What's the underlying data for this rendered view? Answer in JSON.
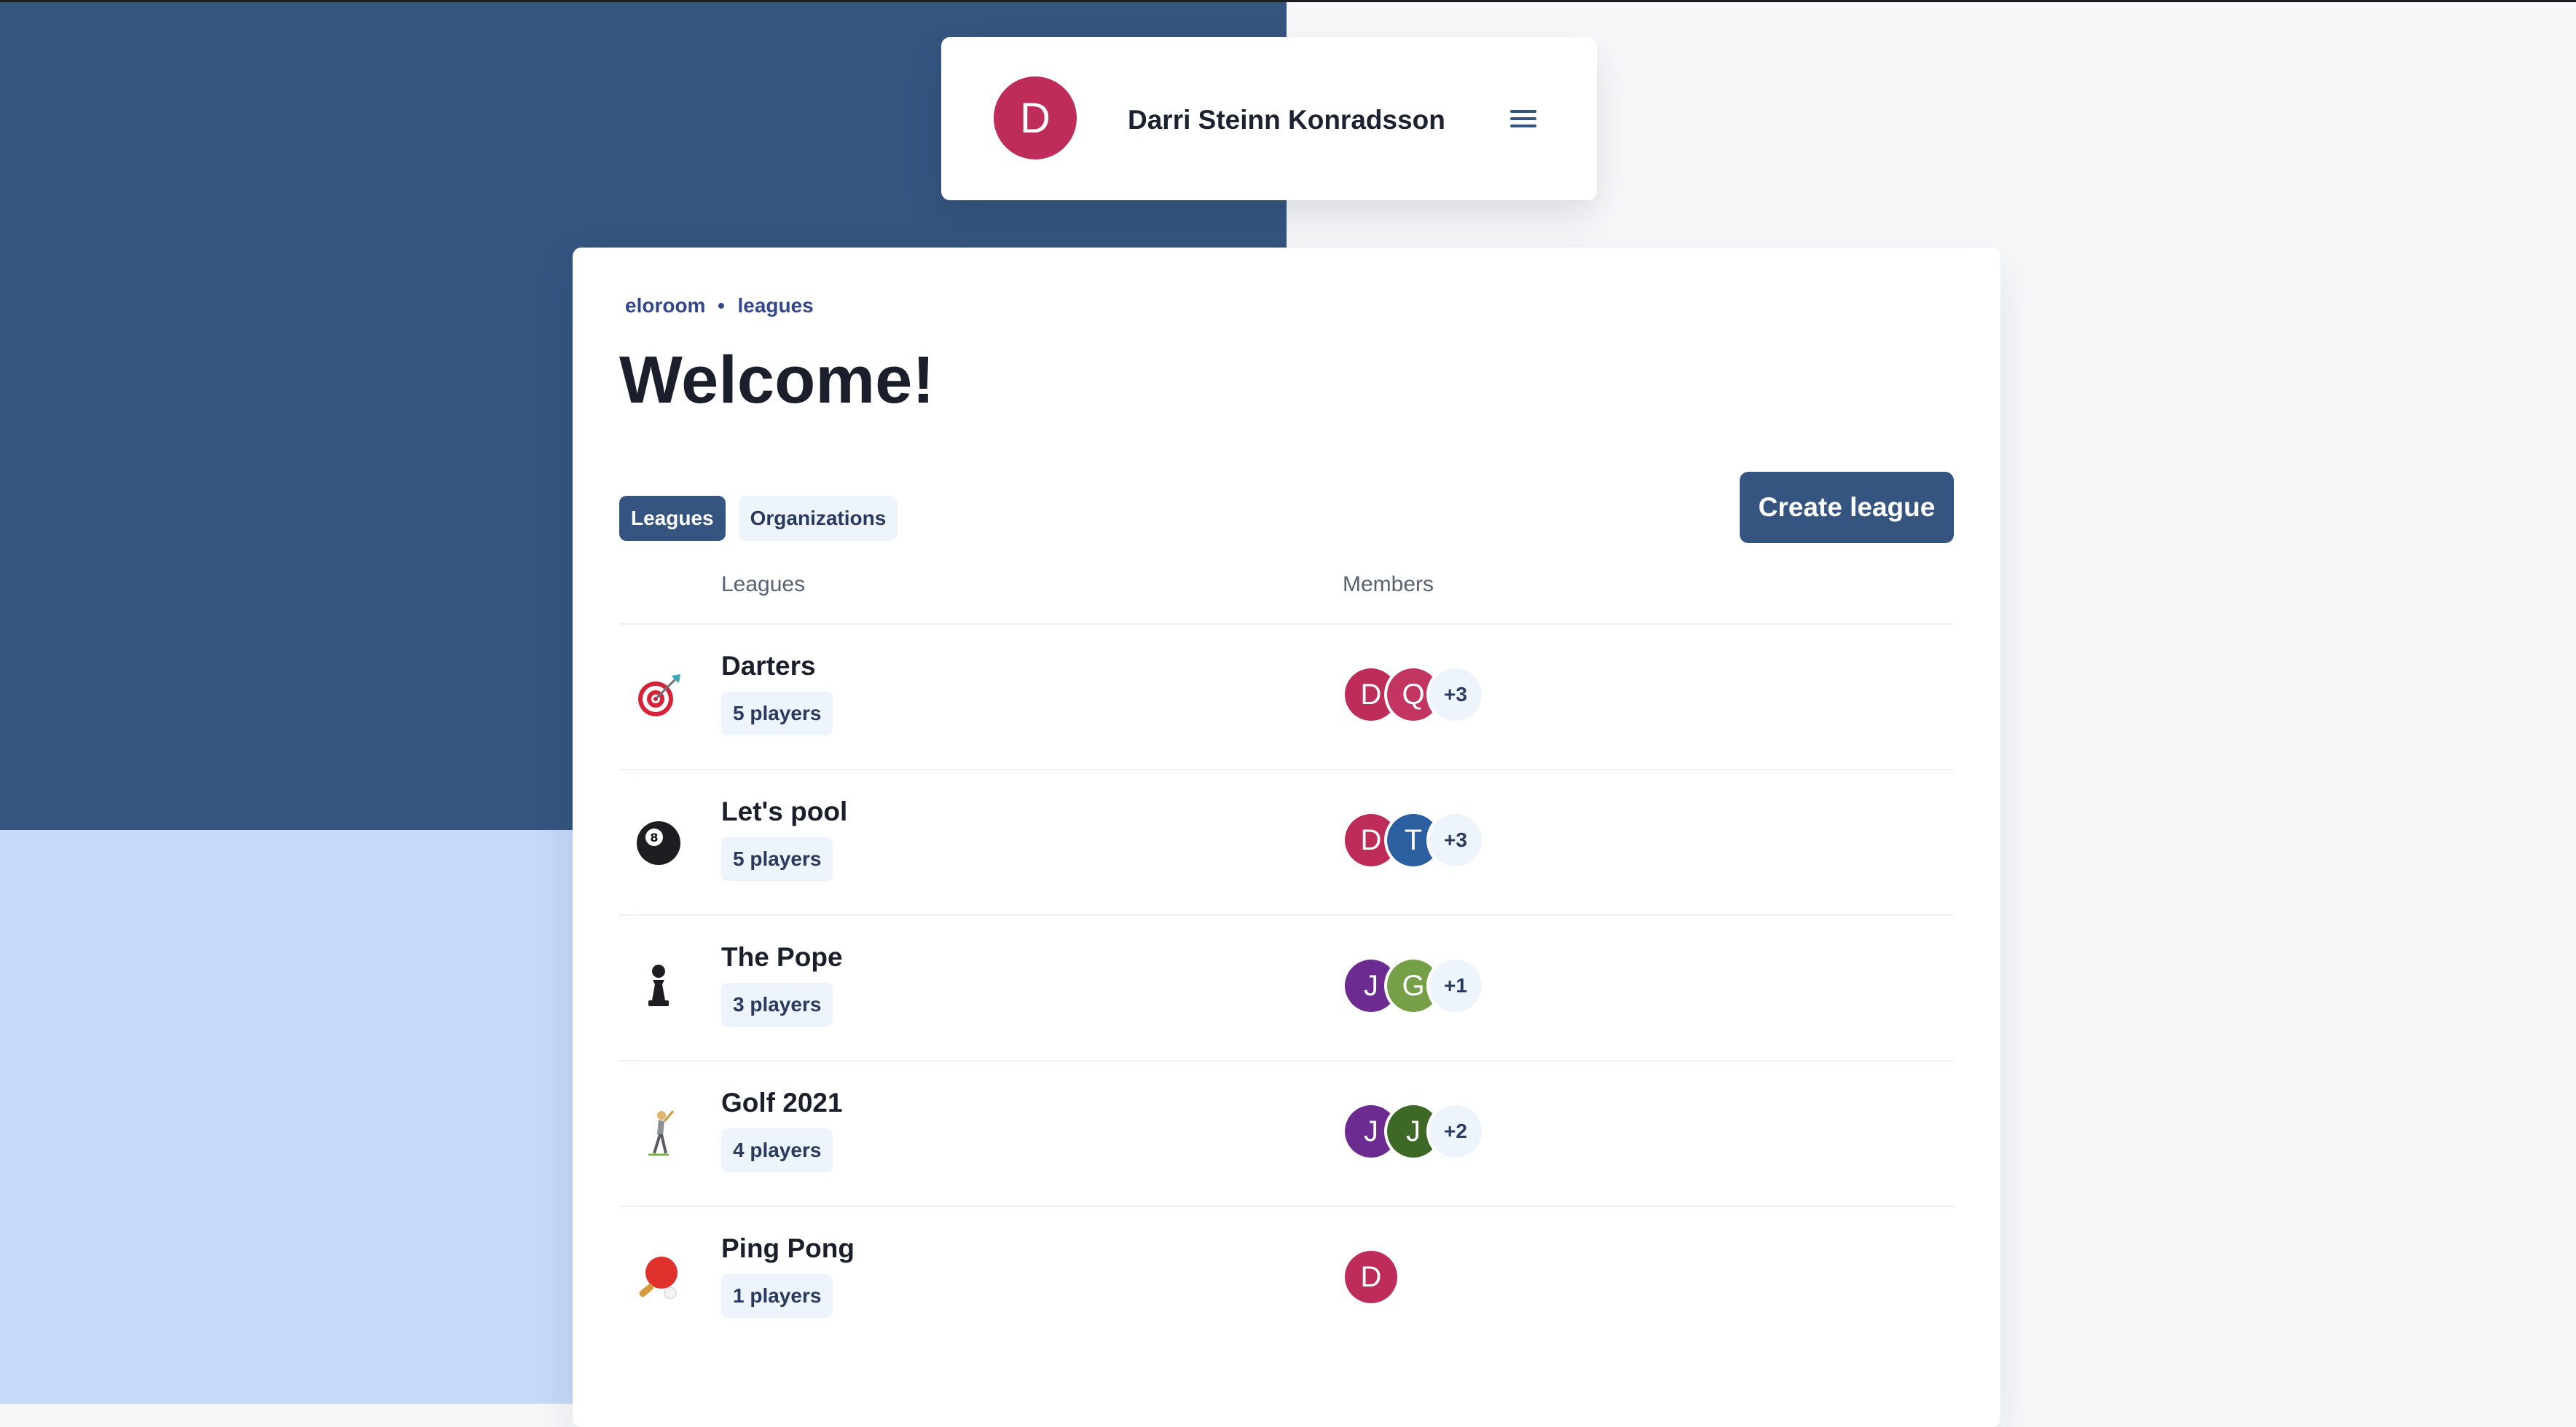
{
  "user": {
    "initial": "D",
    "name": "Darri Steinn Konradsson"
  },
  "breadcrumb": {
    "home": "eloroom",
    "current": "leagues"
  },
  "page": {
    "title": "Welcome!"
  },
  "tabs": [
    {
      "label": "Leagues",
      "active": true
    },
    {
      "label": "Organizations",
      "active": false
    }
  ],
  "actions": {
    "create_league": "Create league"
  },
  "table": {
    "col_leagues": "Leagues",
    "col_members": "Members",
    "rows": [
      {
        "icon": "dart-target-icon",
        "name": "Darters",
        "players": "5 players",
        "avatars": [
          {
            "initial": "D",
            "color": "#be2c5a"
          },
          {
            "initial": "Q",
            "color": "#c23561"
          }
        ],
        "more": "+3"
      },
      {
        "icon": "8-ball-icon",
        "name": "Let's pool",
        "players": "5 players",
        "avatars": [
          {
            "initial": "D",
            "color": "#be2c5a"
          },
          {
            "initial": "T",
            "color": "#2c5fa0"
          }
        ],
        "more": "+3"
      },
      {
        "icon": "chess-pawn-icon",
        "name": "The Pope",
        "players": "3 players",
        "avatars": [
          {
            "initial": "J",
            "color": "#6c2b91"
          },
          {
            "initial": "G",
            "color": "#75a047"
          }
        ],
        "more": "+1"
      },
      {
        "icon": "golfer-icon",
        "name": "Golf 2021",
        "players": "4 players",
        "avatars": [
          {
            "initial": "J",
            "color": "#6c2b91"
          },
          {
            "initial": "J",
            "color": "#3e6826"
          }
        ],
        "more": "+2"
      },
      {
        "icon": "ping-pong-icon",
        "name": "Ping Pong",
        "players": "1 players",
        "avatars": [
          {
            "initial": "D",
            "color": "#be2c5a"
          }
        ],
        "more": ""
      }
    ]
  }
}
